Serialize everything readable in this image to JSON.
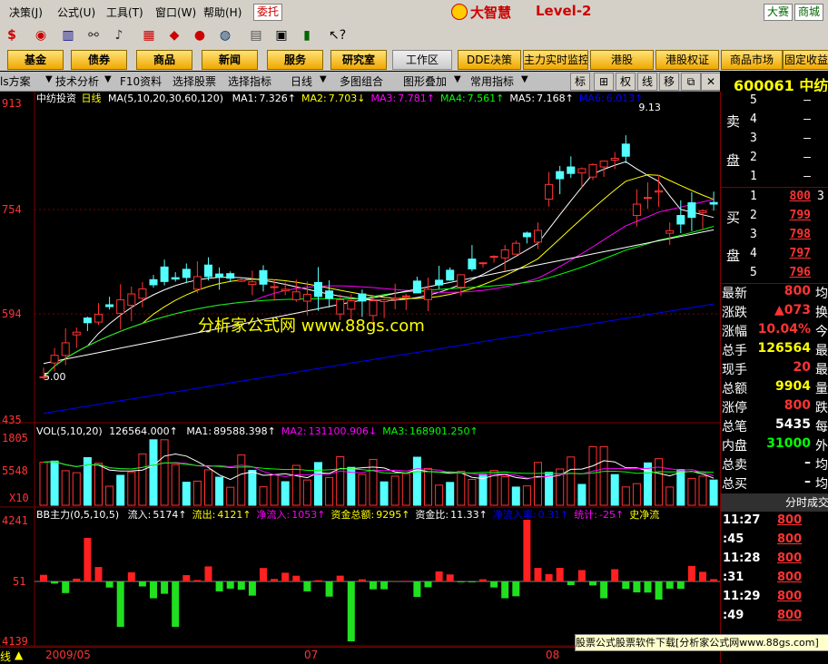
{
  "menu": [
    "决策(J)",
    "公式(U)",
    "工具(T)",
    "窗口(W)",
    "帮助(H)"
  ],
  "top_right": {
    "entrust": "委托",
    "brand": "大智慧",
    "level": "Level-2",
    "btn1": "大赛",
    "btn2": "商城"
  },
  "func_buttons": [
    "基金",
    "债券",
    "商品",
    "新闻",
    "服务",
    "研究室"
  ],
  "func_buttons2": [
    "工作区",
    "DDE决策",
    "主力实时监控",
    "港股",
    "港股权证",
    "商品市场",
    "固定收益"
  ],
  "tabs": [
    "ls方案",
    "技术分析",
    "F10资料",
    "选择股票",
    "选择指标",
    "日线",
    "多图组合",
    "图形叠加",
    "常用指标"
  ],
  "chart_tools": [
    "标",
    "⊞",
    "权",
    "线",
    "移",
    "⧉",
    "✕"
  ],
  "ticker": {
    "code": "600061",
    "name": "中纺投资"
  },
  "main_panel": {
    "stock_name": "中纺投资",
    "period": "日线",
    "ma_label": "MA(5,10,20,30,60,120)",
    "ma_values": [
      {
        "name": "MA1:",
        "value": "7.326↑",
        "color": "#ffffff"
      },
      {
        "name": "MA2:",
        "value": "7.703↓",
        "color": "#ffff00"
      },
      {
        "name": "MA3:",
        "value": "7.781↑",
        "color": "#ff00ff"
      },
      {
        "name": "MA4:",
        "value": "7.561↑",
        "color": "#00ff00"
      },
      {
        "name": "MA5:",
        "value": "7.168↑",
        "color": "#ffffff"
      },
      {
        "name": "MA6:",
        "value": "6.013↑",
        "color": "#0000ff"
      }
    ],
    "y_ticks": [
      "913",
      "754",
      "594",
      "435"
    ],
    "high_label": "9.13",
    "low_label": "5.00",
    "watermark": "分析家公式网 www.88gs.com"
  },
  "vol_panel": {
    "label": "VOL(5,10,20)",
    "value": "126564.000↑",
    "ma": [
      {
        "name": "MA1:",
        "value": "89588.398↑",
        "color": "#ffffff"
      },
      {
        "name": "MA2:",
        "value": "131100.906↓",
        "color": "#ff00ff"
      },
      {
        "name": "MA3:",
        "value": "168901.250↑",
        "color": "#00ff00"
      }
    ],
    "y_ticks": [
      "1805",
      "5548",
      "X10"
    ]
  },
  "bb_panel": {
    "label": "BB主力(0,5,10,5)",
    "items": [
      {
        "name": "流入:",
        "value": "5174↑",
        "color": "#ffffff"
      },
      {
        "name": "流出:",
        "value": "4121↑",
        "color": "#ffff00"
      },
      {
        "name": "净流入:",
        "value": "1053↑",
        "color": "#ff00ff"
      },
      {
        "name": "资金总额:",
        "value": "9295↑",
        "color": "#ffff00"
      },
      {
        "name": "资金比:",
        "value": "11.33↑",
        "color": "#ffffff"
      },
      {
        "name": "净流入率:",
        "value": "0.31↑",
        "color": "#0000ff"
      },
      {
        "name": "统计:",
        "value": "-25↑",
        "color": "#ff00ff"
      },
      {
        "name": "史净流",
        "value": "",
        "color": "#ffff00"
      }
    ],
    "y_ticks": [
      "4241",
      "51",
      "4139"
    ]
  },
  "x_axis": {
    "labels": [
      "2009/05",
      "07",
      "08"
    ],
    "left_tag": "线"
  },
  "orderbook": {
    "sell_label": [
      "卖",
      "盘"
    ],
    "buy_label": [
      "买",
      "盘"
    ],
    "sell": [
      {
        "n": "5",
        "p": "–",
        "v": ""
      },
      {
        "n": "4",
        "p": "–",
        "v": ""
      },
      {
        "n": "3",
        "p": "–",
        "v": ""
      },
      {
        "n": "2",
        "p": "–",
        "v": ""
      },
      {
        "n": "1",
        "p": "–",
        "v": ""
      }
    ],
    "buy": [
      {
        "n": "1",
        "p": "800",
        "v": "3"
      },
      {
        "n": "2",
        "p": "799",
        "v": ""
      },
      {
        "n": "3",
        "p": "798",
        "v": ""
      },
      {
        "n": "4",
        "p": "797",
        "v": ""
      },
      {
        "n": "5",
        "p": "796",
        "v": ""
      }
    ]
  },
  "stats": [
    {
      "label": "最新",
      "value": "800",
      "color": "#ff3333",
      "tail": "均"
    },
    {
      "label": "涨跌",
      "value": "▲073",
      "color": "#ff3333",
      "tail": "换"
    },
    {
      "label": "涨幅",
      "value": "10.04%",
      "color": "#ff3333",
      "tail": "今"
    },
    {
      "label": "总手",
      "value": "126564",
      "color": "#ffff00",
      "tail": "最"
    },
    {
      "label": "现手",
      "value": "20",
      "color": "#ff3333",
      "tail": "最"
    },
    {
      "label": "总额",
      "value": "9904",
      "color": "#ffff00",
      "tail": "量"
    },
    {
      "label": "涨停",
      "value": "800",
      "color": "#ff3333",
      "tail": "跌"
    },
    {
      "label": "总笔",
      "value": "5435",
      "color": "#ffffff",
      "tail": "每"
    },
    {
      "label": "内盘",
      "value": "31000",
      "color": "#00ff00",
      "tail": "外"
    },
    {
      "label": "总卖",
      "value": "–",
      "color": "#ffffff",
      "tail": "均"
    },
    {
      "label": "总买",
      "value": "–",
      "color": "#ffffff",
      "tail": "均"
    }
  ],
  "ts_title": "分时成交",
  "ticks": [
    {
      "t": "11:27",
      "p": "800"
    },
    {
      "t": ":45",
      "p": "800"
    },
    {
      "t": "11:28",
      "p": "800"
    },
    {
      "t": ":31",
      "p": "800"
    },
    {
      "t": "11:29",
      "p": "800"
    },
    {
      "t": ":49",
      "p": "800"
    }
  ],
  "promo": "股票公式股票软件下载[分析家公式网www.88gs.com]"
}
